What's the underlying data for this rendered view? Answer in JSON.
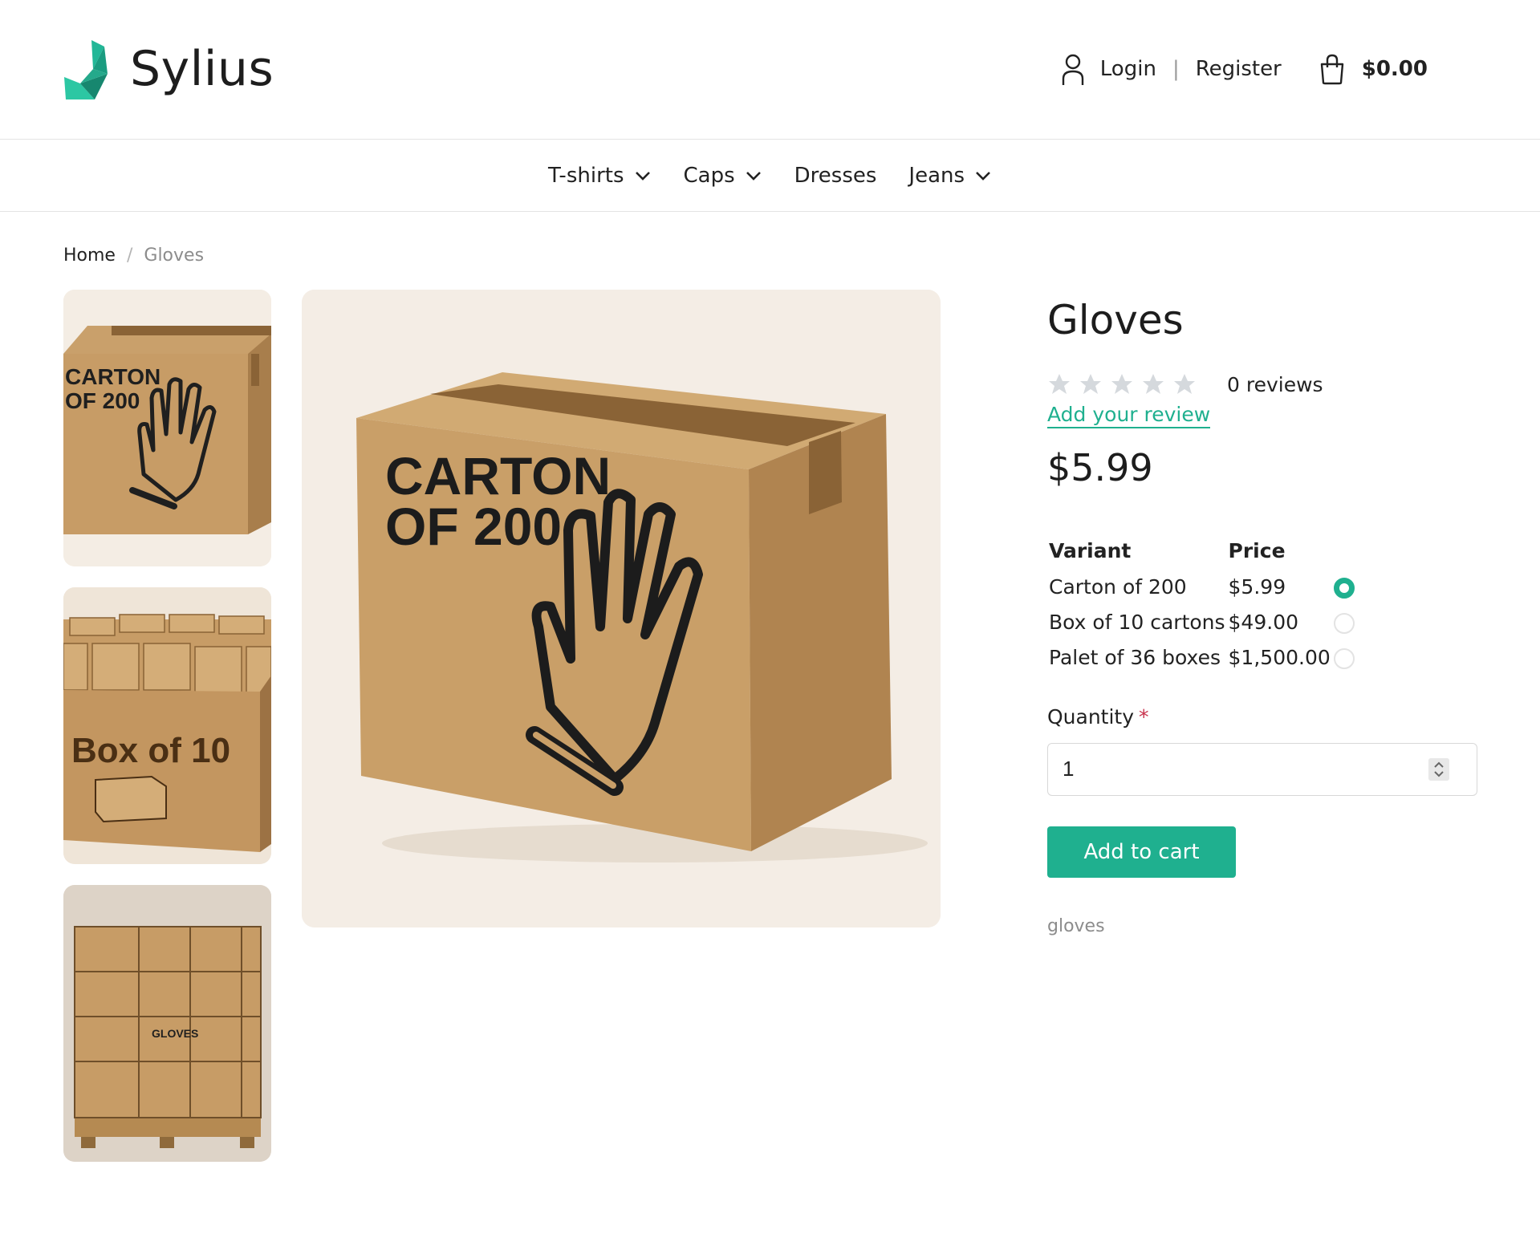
{
  "brand": {
    "name": "Sylius"
  },
  "header": {
    "login_label": "Login",
    "separator": "|",
    "register_label": "Register",
    "cart_total": "$0.00"
  },
  "nav": {
    "items": [
      {
        "label": "T-shirts",
        "has_dropdown": true
      },
      {
        "label": "Caps",
        "has_dropdown": true
      },
      {
        "label": "Dresses",
        "has_dropdown": false
      },
      {
        "label": "Jeans",
        "has_dropdown": true
      }
    ]
  },
  "breadcrumb": {
    "home": "Home",
    "separator": "/",
    "current": "Gloves"
  },
  "images": {
    "main_box_text_line1": "CARTON",
    "main_box_text_line2": "OF 200",
    "thumb1_line1": "CARTON",
    "thumb1_line2": "OF 200",
    "thumb2_text": "Box of 10",
    "thumb3_label": "GLOVES"
  },
  "product": {
    "title": "Gloves",
    "rating_stars": 0,
    "reviews": "0 reviews",
    "add_review": "Add your review",
    "price": "$5.99",
    "variant_header": "Variant",
    "price_header": "Price",
    "variants": [
      {
        "name": "Carton of 200",
        "price": "$5.99",
        "selected": true
      },
      {
        "name": "Box of 10 cartons",
        "price": "$49.00",
        "selected": false
      },
      {
        "name": "Palet of 36 boxes",
        "price": "$1,500.00",
        "selected": false
      }
    ],
    "quantity_label": "Quantity",
    "required_mark": "*",
    "quantity": "1",
    "add_to_cart": "Add to cart",
    "tag": "gloves"
  },
  "colors": {
    "accent": "#1fb08f",
    "required": "#c8334d",
    "star": "#d5d9dd"
  }
}
